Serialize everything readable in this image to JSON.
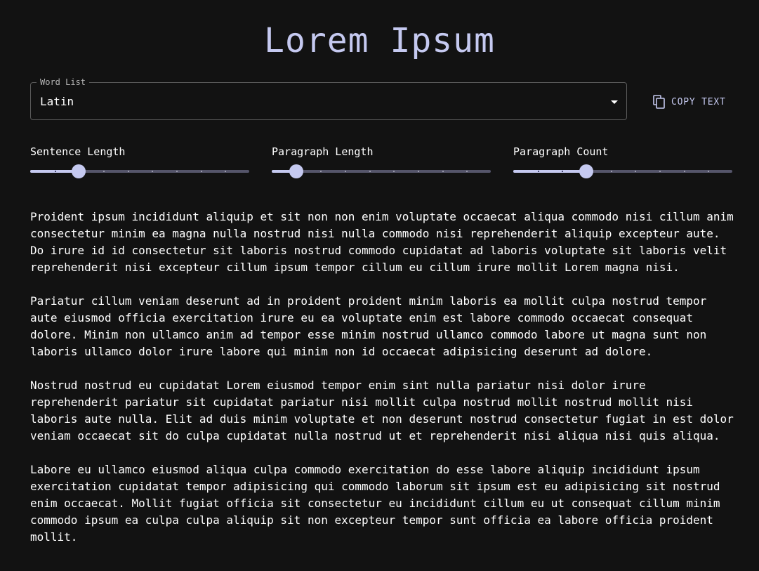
{
  "header": {
    "title": "Lorem Ipsum"
  },
  "word_list": {
    "label": "Word List",
    "value": "Latin",
    "icon": "arrow-drop-down-icon"
  },
  "copy_button": {
    "label": "COPY TEXT",
    "icon": "copy-icon"
  },
  "sliders": [
    {
      "label": "Sentence Length",
      "value_fraction": 0.222,
      "steps": 9
    },
    {
      "label": "Paragraph Length",
      "value_fraction": 0.111,
      "steps": 9
    },
    {
      "label": "Paragraph Count",
      "value_fraction": 0.333,
      "steps": 9
    }
  ],
  "paragraphs": [
    "Proident ipsum incididunt aliquip et sit non non enim voluptate occaecat aliqua commodo nisi cillum anim consectetur minim ea magna nulla nostrud nisi nulla commodo nisi reprehenderit aliquip excepteur aute. Do irure id id consectetur sit laboris nostrud commodo cupidatat ad laboris voluptate sit laboris velit reprehenderit nisi excepteur cillum ipsum tempor cillum eu cillum irure mollit Lorem magna nisi.",
    "Pariatur cillum veniam deserunt ad in proident proident minim laboris ea mollit culpa nostrud tempor aute eiusmod officia exercitation irure eu ea voluptate enim est labore commodo occaecat consequat dolore. Minim non ullamco anim ad tempor esse minim nostrud ullamco commodo labore ut magna sunt non laboris ullamco dolor irure labore qui minim non id occaecat adipisicing deserunt ad dolore.",
    "Nostrud nostrud eu cupidatat Lorem eiusmod tempor enim sint nulla pariatur nisi dolor irure reprehenderit pariatur sit cupidatat pariatur nisi mollit culpa nostrud mollit nostrud mollit nisi laboris aute nulla. Elit ad duis minim voluptate et non deserunt nostrud consectetur fugiat in est dolor veniam occaecat sit do culpa cupidatat nulla nostrud ut et reprehenderit nisi aliqua nisi quis aliqua.",
    "Labore eu ullamco eiusmod aliqua culpa commodo exercitation do esse labore aliquip incididunt ipsum exercitation cupidatat tempor adipisicing qui commodo laborum sit ipsum est eu adipisicing sit nostrud enim occaecat. Mollit fugiat officia sit consectetur eu incididunt cillum eu ut consequat cillum minim commodo ipsum ea culpa culpa aliquip sit non excepteur tempor sunt officia ea labore officia proident mollit."
  ],
  "colors": {
    "background": "#121212",
    "accent": "#c5c9f0",
    "track": "#55556a",
    "text": "#ffffff"
  }
}
